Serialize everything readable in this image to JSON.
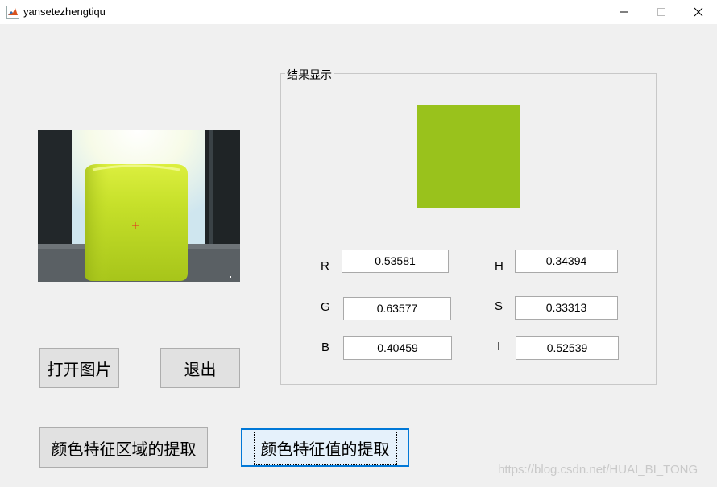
{
  "window": {
    "title": "yansetezhengtiqu",
    "minimize_icon": "minimize-icon",
    "maximize_icon": "maximize-icon",
    "close_icon": "close-icon"
  },
  "image_panel": {
    "description_icon": "image-preview",
    "marker": "+"
  },
  "result_group": {
    "title": "结果显示",
    "swatch_color": "#99c21c",
    "values": {
      "R": {
        "label": "R",
        "value": "0.53581"
      },
      "G": {
        "label": "G",
        "value": "0.63577"
      },
      "B": {
        "label": "B",
        "value": "0.40459"
      },
      "H": {
        "label": "H",
        "value": "0.34394"
      },
      "S": {
        "label": "S",
        "value": "0.33313"
      },
      "I": {
        "label": "I",
        "value": "0.52539"
      }
    }
  },
  "buttons": {
    "open_image": "打开图片",
    "exit": "退出",
    "extract_region": "颜色特征区域的提取",
    "extract_value": "颜色特征值的提取"
  },
  "watermark": "https://blog.csdn.net/HUAI_BI_TONG"
}
